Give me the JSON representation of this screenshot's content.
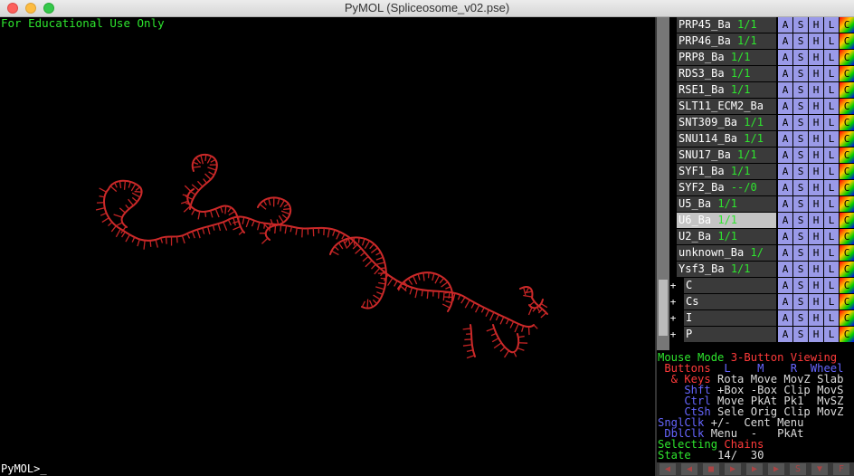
{
  "window": {
    "title": "PyMOL (Spliceosome_v02.pse)"
  },
  "viewer": {
    "watermark": "For Educational Use Only",
    "prompt": "PyMOL>_"
  },
  "objects": [
    {
      "name": "PRP45_Ba",
      "state": "1/1",
      "group": false,
      "highlight": false
    },
    {
      "name": "PRP46_Ba",
      "state": "1/1",
      "group": false,
      "highlight": false
    },
    {
      "name": "PRP8_Ba",
      "state": "1/1",
      "group": false,
      "highlight": false
    },
    {
      "name": "RDS3_Ba",
      "state": "1/1",
      "group": false,
      "highlight": false
    },
    {
      "name": "RSE1_Ba",
      "state": "1/1",
      "group": false,
      "highlight": false
    },
    {
      "name": "SLT11_ECM2_Ba",
      "state": "",
      "group": false,
      "highlight": false
    },
    {
      "name": "SNT309_Ba",
      "state": "1/1",
      "group": false,
      "highlight": false
    },
    {
      "name": "SNU114_Ba",
      "state": "1/1",
      "group": false,
      "highlight": false
    },
    {
      "name": "SNU17_Ba",
      "state": "1/1",
      "group": false,
      "highlight": false
    },
    {
      "name": "SYF1_Ba",
      "state": "1/1",
      "group": false,
      "highlight": false
    },
    {
      "name": "SYF2_Ba",
      "state": "--/0",
      "group": false,
      "highlight": false
    },
    {
      "name": "U5_Ba",
      "state": "1/1",
      "group": false,
      "highlight": false
    },
    {
      "name": "U6_Ba",
      "state": "1/1",
      "group": false,
      "highlight": true
    },
    {
      "name": "U2_Ba",
      "state": "1/1",
      "group": false,
      "highlight": false
    },
    {
      "name": "unknown_Ba",
      "state": "1/",
      "group": false,
      "highlight": false
    },
    {
      "name": "Ysf3_Ba",
      "state": "1/1",
      "group": false,
      "highlight": false
    },
    {
      "name": "C",
      "state": "",
      "group": true,
      "highlight": false
    },
    {
      "name": "Cs",
      "state": "",
      "group": true,
      "highlight": false
    },
    {
      "name": "I",
      "state": "",
      "group": true,
      "highlight": false
    },
    {
      "name": "P",
      "state": "",
      "group": true,
      "highlight": false
    }
  ],
  "buttons": {
    "a": "A",
    "s": "S",
    "h": "H",
    "l": "L",
    "c": "C",
    "expand": "+"
  },
  "mouse": {
    "l1a": "Mouse Mode ",
    "l1b": "3-Button Viewing",
    "l2a": " Buttons ",
    "l2b": " L    ",
    "l2c": "M    ",
    "l2d": "R  ",
    "l2e": "Wheel",
    "l3a": "  & Keys ",
    "l3b": "Rota Move MovZ Slab",
    "l4a": "    Shft ",
    "l4b": "+Box -Box Clip MovS",
    "l5a": "    Ctrl ",
    "l5b": "Move PkAt Pk1  MvSZ",
    "l6a": "    CtSh ",
    "l6b": "Sele Orig Clip MovZ",
    "l7a": "SnglClk ",
    "l7b": "+/-  Cent Menu",
    "l8a": " DblClk ",
    "l8b": "Menu  -   PkAt",
    "l9a": "Selecting ",
    "l9b": "Chains",
    "l10a": "State   ",
    "l10b": " 14/  30"
  },
  "playback": [
    "◀",
    "◀",
    "■",
    "▶",
    "▶",
    "▶",
    "S",
    "▼",
    "F"
  ],
  "colors": {
    "green": "#2ee62e",
    "rna": "#cc2a2a",
    "button_blue": "#9a9ae8"
  }
}
